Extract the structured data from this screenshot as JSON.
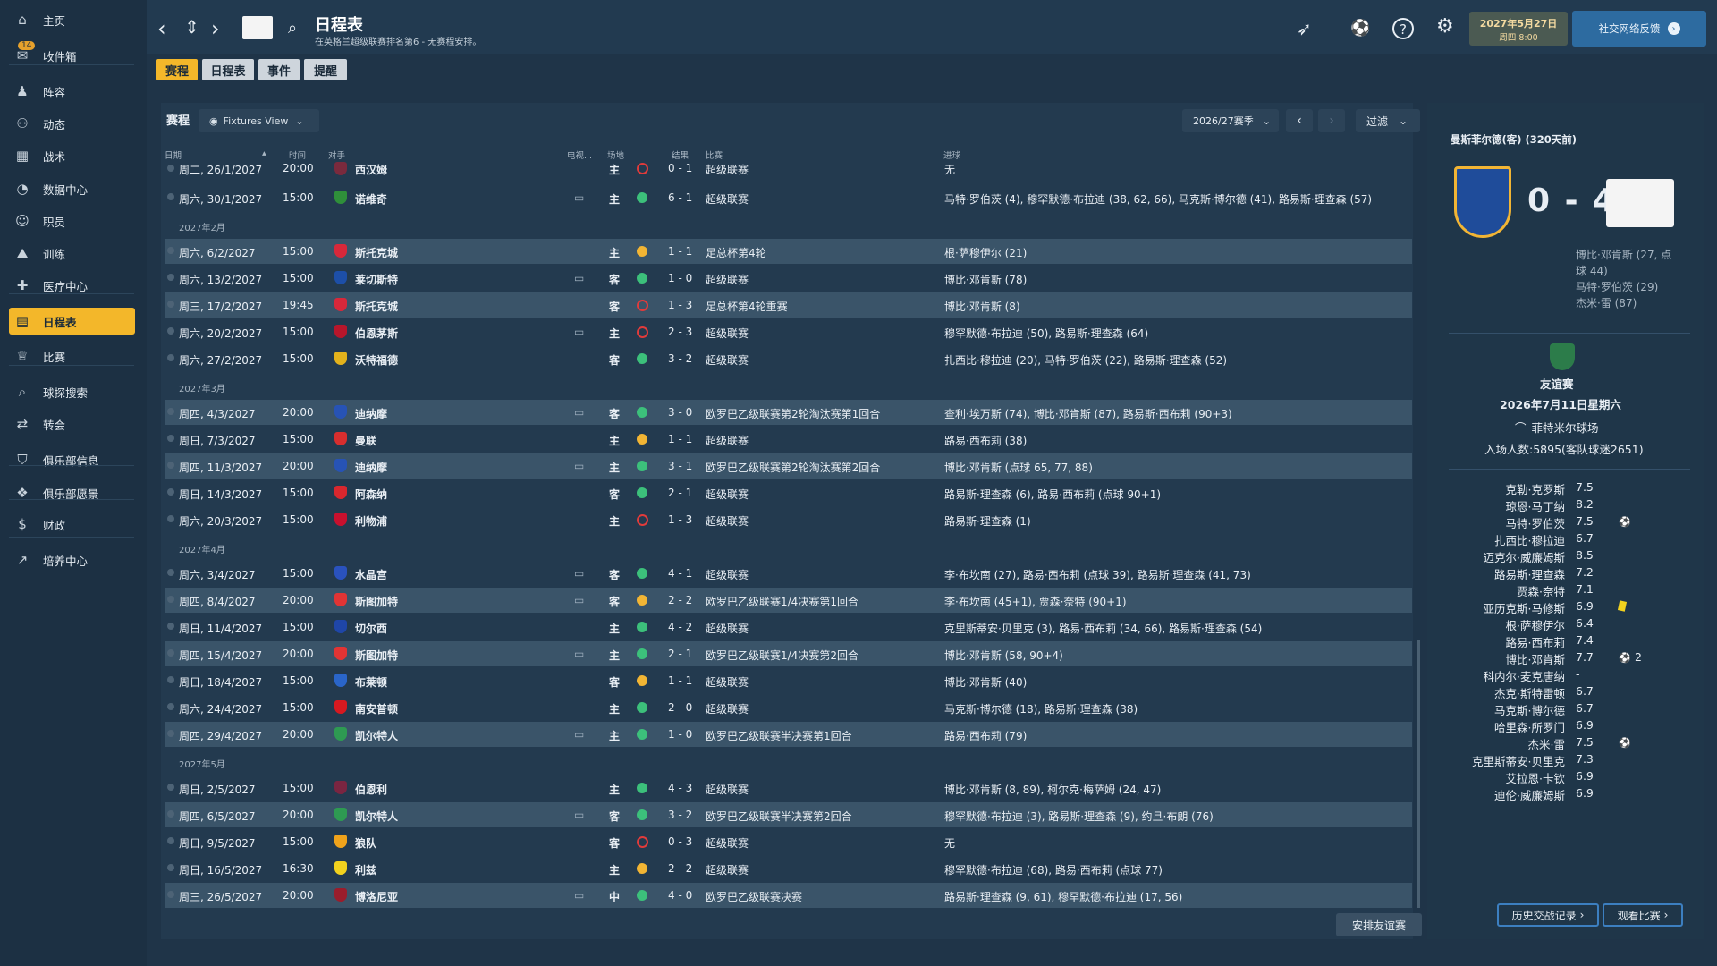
{
  "sidebar": {
    "items": [
      {
        "label": "主页",
        "icon": "home-icon"
      },
      {
        "label": "收件箱",
        "icon": "inbox-icon",
        "badge": "14"
      },
      {
        "label": "阵容",
        "icon": "squad-icon"
      },
      {
        "label": "动态",
        "icon": "dynamics-icon"
      },
      {
        "label": "战术",
        "icon": "tactics-icon"
      },
      {
        "label": "数据中心",
        "icon": "data-hub-icon"
      },
      {
        "label": "职员",
        "icon": "staff-icon"
      },
      {
        "label": "训练",
        "icon": "training-icon"
      },
      {
        "label": "医疗中心",
        "icon": "medical-icon"
      },
      {
        "label": "日程表",
        "icon": "calendar-icon",
        "active": true
      },
      {
        "label": "比赛",
        "icon": "trophy-icon"
      },
      {
        "label": "球探搜索",
        "icon": "scouting-icon"
      },
      {
        "label": "转会",
        "icon": "transfers-icon"
      },
      {
        "label": "俱乐部信息",
        "icon": "club-info-icon"
      },
      {
        "label": "俱乐部愿景",
        "icon": "club-vision-icon"
      },
      {
        "label": "财政",
        "icon": "finance-icon"
      },
      {
        "label": "培养中心",
        "icon": "development-icon"
      }
    ]
  },
  "header": {
    "title": "日程表",
    "subtitle": "在英格兰超级联赛排名第6 - 无赛程安排。",
    "date_line1": "2027年5月27日",
    "date_line2": "周四 8:00",
    "feedback_label": "社交网络反馈"
  },
  "tabs": [
    "赛程",
    "日程表",
    "事件",
    "提醒"
  ],
  "fixtures": {
    "section_title": "赛程",
    "view_label": "Fixtures View",
    "season_label": "2026/27赛季",
    "filter_label": "过滤",
    "arrange_label": "安排友谊赛",
    "columns": {
      "date": "日期",
      "time": "时间",
      "opponent": "对手",
      "tv": "电视...",
      "venue": "场地",
      "result": "结果",
      "competition": "比赛",
      "scorers": "进球"
    },
    "months": [
      "2027年2月",
      "2027年3月",
      "2027年4月",
      "2027年5月"
    ],
    "rows": [
      {
        "date": "周二, 26/1/2027",
        "time": "20:00",
        "opp": "西汉姆",
        "tv": false,
        "venue": "主",
        "res": "L",
        "score": "0 - 1",
        "comp": "超级联赛",
        "goals": "无",
        "crest": "#7a2a3d",
        "cup": false
      },
      {
        "date": "周六, 30/1/2027",
        "time": "15:00",
        "opp": "诺维奇",
        "tv": true,
        "venue": "主",
        "res": "W",
        "score": "6 - 1",
        "comp": "超级联赛",
        "goals": "马特·罗伯茨 (4), 穆罕默德·布拉迪 (38, 62, 66), 马克斯·博尔德 (41), 路易斯·理查森 (57)",
        "crest": "#2f8f3a",
        "cup": false
      },
      {
        "date": "周六, 6/2/2027",
        "time": "15:00",
        "opp": "斯托克城",
        "tv": false,
        "venue": "主",
        "res": "D",
        "score": "1 - 1",
        "comp": "足总杯第4轮",
        "goals": "根·萨穆伊尔 (21)",
        "crest": "#d8283a",
        "cup": true
      },
      {
        "date": "周六, 13/2/2027",
        "time": "15:00",
        "opp": "莱切斯特",
        "tv": true,
        "venue": "客",
        "res": "W",
        "score": "1 - 0",
        "comp": "超级联赛",
        "goals": "博比·邓肯斯 (78)",
        "crest": "#1d4fa8",
        "cup": false
      },
      {
        "date": "周三, 17/2/2027",
        "time": "19:45",
        "opp": "斯托克城",
        "tv": false,
        "venue": "客",
        "res": "L",
        "score": "1 - 3",
        "comp": "足总杯第4轮重赛",
        "goals": "博比·邓肯斯 (8)",
        "crest": "#d8283a",
        "cup": true
      },
      {
        "date": "周六, 20/2/2027",
        "time": "15:00",
        "opp": "伯恩茅斯",
        "tv": true,
        "venue": "主",
        "res": "L",
        "score": "2 - 3",
        "comp": "超级联赛",
        "goals": "穆罕默德·布拉迪 (50), 路易斯·理查森 (64)",
        "crest": "#b7162b",
        "cup": false
      },
      {
        "date": "周六, 27/2/2027",
        "time": "15:00",
        "opp": "沃特福德",
        "tv": false,
        "venue": "客",
        "res": "W",
        "score": "3 - 2",
        "comp": "超级联赛",
        "goals": "扎西比·穆拉迪 (20), 马特·罗伯茨 (22), 路易斯·理查森 (52)",
        "crest": "#e3b21c",
        "cup": false
      },
      {
        "date": "周四, 4/3/2027",
        "time": "20:00",
        "opp": "迪纳摩",
        "tv": true,
        "venue": "客",
        "res": "W",
        "score": "3 - 0",
        "comp": "欧罗巴乙级联赛第2轮淘汰赛第1回合",
        "goals": "查利·埃万斯 (74), 博比·邓肯斯 (87), 路易斯·西布莉 (90+3)",
        "crest": "#2753b5",
        "cup": true
      },
      {
        "date": "周日, 7/3/2027",
        "time": "15:00",
        "opp": "曼联",
        "tv": false,
        "venue": "主",
        "res": "D",
        "score": "1 - 1",
        "comp": "超级联赛",
        "goals": "路易·西布莉 (38)",
        "crest": "#d82e2e",
        "cup": false
      },
      {
        "date": "周四, 11/3/2027",
        "time": "20:00",
        "opp": "迪纳摩",
        "tv": true,
        "venue": "主",
        "res": "W",
        "score": "3 - 1",
        "comp": "欧罗巴乙级联赛第2轮淘汰赛第2回合",
        "goals": "博比·邓肯斯 (点球 65, 77, 88)",
        "crest": "#2753b5",
        "cup": true
      },
      {
        "date": "周日, 14/3/2027",
        "time": "15:00",
        "opp": "阿森纳",
        "tv": false,
        "venue": "客",
        "res": "W",
        "score": "2 - 1",
        "comp": "超级联赛",
        "goals": "路易斯·理查森 (6), 路易·西布莉 (点球 90+1)",
        "crest": "#d9272e",
        "cup": false
      },
      {
        "date": "周六, 20/3/2027",
        "time": "15:00",
        "opp": "利物浦",
        "tv": false,
        "venue": "主",
        "res": "L",
        "score": "1 - 3",
        "comp": "超级联赛",
        "goals": "路易斯·理查森 (1)",
        "crest": "#c8102e",
        "cup": false
      },
      {
        "date": "周六, 3/4/2027",
        "time": "15:00",
        "opp": "水晶宫",
        "tv": true,
        "venue": "客",
        "res": "W",
        "score": "4 - 1",
        "comp": "超级联赛",
        "goals": "李·布坎南 (27), 路易·西布莉 (点球 39), 路易斯·理查森 (41, 73)",
        "crest": "#2a52be",
        "cup": false
      },
      {
        "date": "周四, 8/4/2027",
        "time": "20:00",
        "opp": "斯图加特",
        "tv": true,
        "venue": "客",
        "res": "D",
        "score": "2 - 2",
        "comp": "欧罗巴乙级联赛1/4决赛第1回合",
        "goals": "李·布坎南 (45+1), 贾森·奈特 (90+1)",
        "crest": "#e23434",
        "cup": true
      },
      {
        "date": "周日, 11/4/2027",
        "time": "15:00",
        "opp": "切尔西",
        "tv": false,
        "venue": "主",
        "res": "W",
        "score": "4 - 2",
        "comp": "超级联赛",
        "goals": "克里斯蒂安·贝里克 (3), 路易·西布莉 (34, 66), 路易斯·理查森 (54)",
        "crest": "#1f46a8",
        "cup": false
      },
      {
        "date": "周四, 15/4/2027",
        "time": "20:00",
        "opp": "斯图加特",
        "tv": true,
        "venue": "主",
        "res": "W",
        "score": "2 - 1",
        "comp": "欧罗巴乙级联赛1/4决赛第2回合",
        "goals": "博比·邓肯斯 (58, 90+4)",
        "crest": "#e23434",
        "cup": true
      },
      {
        "date": "周日, 18/4/2027",
        "time": "15:00",
        "opp": "布莱顿",
        "tv": false,
        "venue": "客",
        "res": "D",
        "score": "1 - 1",
        "comp": "超级联赛",
        "goals": "博比·邓肯斯 (40)",
        "crest": "#2a65c9",
        "cup": false
      },
      {
        "date": "周六, 24/4/2027",
        "time": "15:00",
        "opp": "南安普顿",
        "tv": false,
        "venue": "主",
        "res": "W",
        "score": "2 - 0",
        "comp": "超级联赛",
        "goals": "马克斯·博尔德 (18), 路易斯·理查森 (38)",
        "crest": "#d71920",
        "cup": false
      },
      {
        "date": "周四, 29/4/2027",
        "time": "20:00",
        "opp": "凯尔特人",
        "tv": true,
        "venue": "主",
        "res": "W",
        "score": "1 - 0",
        "comp": "欧罗巴乙级联赛半决赛第1回合",
        "goals": "路易·西布莉 (79)",
        "crest": "#2e9a52",
        "cup": true
      },
      {
        "date": "周日, 2/5/2027",
        "time": "15:00",
        "opp": "伯恩利",
        "tv": false,
        "venue": "主",
        "res": "W",
        "score": "4 - 3",
        "comp": "超级联赛",
        "goals": "博比·邓肯斯 (8, 89), 柯尔克·梅萨姆 (24, 47)",
        "crest": "#7a2541",
        "cup": false
      },
      {
        "date": "周四, 6/5/2027",
        "time": "20:00",
        "opp": "凯尔特人",
        "tv": true,
        "venue": "客",
        "res": "W",
        "score": "3 - 2",
        "comp": "欧罗巴乙级联赛半决赛第2回合",
        "goals": "穆罕默德·布拉迪 (3), 路易斯·理查森 (9), 约旦·布朗 (76)",
        "crest": "#2e9a52",
        "cup": true
      },
      {
        "date": "周日, 9/5/2027",
        "time": "15:00",
        "opp": "狼队",
        "tv": false,
        "venue": "客",
        "res": "L",
        "score": "0 - 3",
        "comp": "超级联赛",
        "goals": "无",
        "crest": "#f0a31b",
        "cup": false
      },
      {
        "date": "周日, 16/5/2027",
        "time": "16:30",
        "opp": "利兹",
        "tv": false,
        "venue": "主",
        "res": "D",
        "score": "2 - 2",
        "comp": "超级联赛",
        "goals": "穆罕默德·布拉迪 (68), 路易·西布莉 (点球 77)",
        "crest": "#f2d21e",
        "cup": false
      },
      {
        "date": "周三, 26/5/2027",
        "time": "20:00",
        "opp": "博洛尼亚",
        "tv": true,
        "venue": "中",
        "res": "W",
        "score": "4 - 0",
        "comp": "欧罗巴乙级联赛决赛",
        "goals": "路易斯·理查森 (9, 61), 穆罕默德·布拉迪 (17, 56)",
        "crest": "#9a1d2c",
        "cup": true
      }
    ]
  },
  "match_panel": {
    "title": "曼斯菲尔德(客) (320天前)",
    "score": "0 - 4",
    "scorers": [
      "博比·邓肯斯 (27, 点",
      "球 44)",
      "马特·罗伯茨 (29)",
      "杰米·雷 (87)"
    ],
    "competition": "友谊赛",
    "match_date": "2026年7月11日星期六",
    "stadium": "菲特米尔球场",
    "attendance": "入场人数:5895(客队球迷2651)",
    "players": [
      {
        "name": "克勒·克罗斯",
        "rating": "7.5",
        "icon": ""
      },
      {
        "name": "琼恩·马丁纳",
        "rating": "8.2",
        "icon": ""
      },
      {
        "name": "马特·罗伯茨",
        "rating": "7.5",
        "icon": "ball"
      },
      {
        "name": "扎西比·穆拉迪",
        "rating": "6.7",
        "icon": ""
      },
      {
        "name": "迈克尔·威廉姆斯",
        "rating": "8.5",
        "icon": ""
      },
      {
        "name": "路易斯·理查森",
        "rating": "7.2",
        "icon": ""
      },
      {
        "name": "贾森·奈特",
        "rating": "7.1",
        "icon": ""
      },
      {
        "name": "亚历克斯·马修斯",
        "rating": "6.9",
        "icon": "yellow"
      },
      {
        "name": "根·萨穆伊尔",
        "rating": "6.4",
        "icon": ""
      },
      {
        "name": "路易·西布莉",
        "rating": "7.4",
        "icon": ""
      },
      {
        "name": "博比·邓肯斯",
        "rating": "7.7",
        "icon": "ball2"
      },
      {
        "name": "科内尔·麦克唐纳",
        "rating": "-",
        "icon": ""
      },
      {
        "name": "杰克·斯特雷顿",
        "rating": "6.7",
        "icon": ""
      },
      {
        "name": "马克斯·博尔德",
        "rating": "6.7",
        "icon": ""
      },
      {
        "name": "哈里森·所罗门",
        "rating": "6.9",
        "icon": ""
      },
      {
        "name": "杰米·雷",
        "rating": "7.5",
        "icon": "ball"
      },
      {
        "name": "克里斯蒂安·贝里克",
        "rating": "7.3",
        "icon": ""
      },
      {
        "name": "艾拉恩·卡钦",
        "rating": "6.9",
        "icon": ""
      },
      {
        "name": "迪伦·威廉姆斯",
        "rating": "6.9",
        "icon": ""
      }
    ],
    "goals_count": "2",
    "history_label": "历史交战记录",
    "watch_label": "观看比赛"
  },
  "colors": {
    "win": "#3cc07b",
    "draw": "#f2b534",
    "loss": "#e13b3b",
    "accent": "#f3b72a"
  }
}
